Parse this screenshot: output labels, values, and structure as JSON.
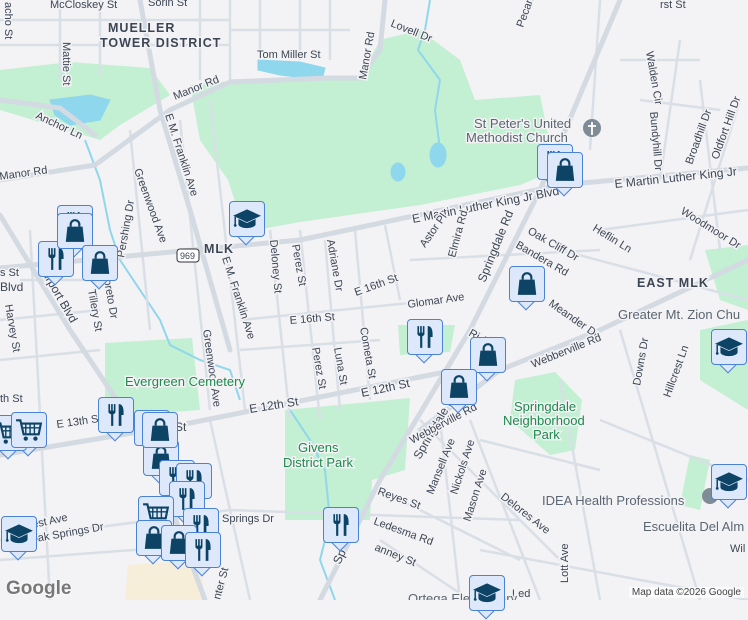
{
  "colors": {
    "background": "#f3f2f4",
    "park": "#c3efd3",
    "water": "#8fd7ec",
    "road": "#d5dce3",
    "marker_fill": "#dde8fb",
    "marker_border": "#4a83d6",
    "icon": "#0d4466"
  },
  "labels": {
    "mueller_1": "MUELLER",
    "mueller_2": "TOWER DISTRICT",
    "east_mlk": "EAST MLK",
    "mccloskey": "McCloskey St",
    "sorin": "Sorin St",
    "camacho": "acho St",
    "mattie": "Mattie St",
    "tom_miller": "Tom Miller St",
    "manor_rd_1": "Manor Rd",
    "manor_rd_2": "Manor Rd",
    "manor_rd_3": "Manor Rd",
    "anchor": "Anchor Ln",
    "lovell": "Lovell Dr",
    "pecan": "Pecan",
    "emfranklin_1": "E M. Franklin Ave",
    "emfranklin_2": "E M. Franklin Ave",
    "greenwood_1": "Greenwood Ave",
    "greenwood_2": "Greenwood Ave",
    "pershing": "Pershing Dr",
    "mlk": "MLK",
    "hwy": "969",
    "deloney": "Deloney St",
    "perez_1": "Perez St",
    "perez_2": "Perez St",
    "adriane": "Adriane Dr",
    "luna": "Luna St",
    "cometa": "Cometa St",
    "e16th_1": "E 16th St",
    "e16th_2": "E 16th St",
    "e12th_1": "E 12th St",
    "e12th_2": "E 12th St",
    "e13th": "E 13th St",
    "mlk_long_1": "E Martin Luther King Jr Blvd",
    "mlk_long_2": "E Martin Luther King Jr",
    "springdale_1": "Springdale Rd",
    "springdale_2": "Springdale Rd",
    "springdale_3": "Sp",
    "astor": "Astor Pl",
    "elmira": "Elmira Rd",
    "oak_cliff": "Oak Cliff Dr",
    "bandera": "Bandera Rd",
    "heflin": "Heflin Ln",
    "woodmoor": "Woodmoor Dr",
    "walden": "Walden Cir",
    "bundyhill": "Bundyhill Dr",
    "broadhill": "Broadhill Dr",
    "oldfort": "Oldfort Hill Dr",
    "glomar": "Glomar Ave",
    "meander": "Meander Dr",
    "ridge": "Ri     Ave",
    "webberville_1": "Webberville Rd",
    "webberville_2": "Webberville Rd",
    "downs": "Downs Dr",
    "hillcrest": "Hillcrest Ln",
    "mansell": "Mansell Ave",
    "nickols": "Nickols Ave",
    "mason": "Mason Ave",
    "delores": "Delores Ave",
    "lott": "Lott Ave",
    "reyes": "Reyes St",
    "ledesma": "Ledesma Rd",
    "channey": "anney St",
    "airport": "Airport Blvd",
    "blvd": "Blvd",
    "harvey": "Harvey St",
    "tillery": "Tillery St",
    "loreto": "oreto Dr",
    "oak_springs": "Oak Springs Dr",
    "springs_dr": "Springs Dr",
    "crest": "est Ave",
    "center": "nter St",
    "bs_st": "s St",
    "th_st": "th St",
    "rst_st": "rst St",
    "wil": "Wil",
    "st_12": "St",
    "led": "Led",
    "evergreen": "Evergreen Cemetery",
    "givens_1": "Givens",
    "givens_2": "District Park",
    "springdale_park_1": "Springdale",
    "springdale_park_2": "Neighborhood",
    "springdale_park_3": "Park",
    "st_peters_1": "St Peter's United",
    "st_peters_2": "Methodist Church",
    "mt_zion": "Greater Mt. Zion Chu",
    "idea": "IDEA Health Professions",
    "escuelita": "Escuelita Del Alm",
    "ortega": "Ortega Elementary"
  },
  "markers": [
    "restaurant",
    "school",
    "restaurant",
    "shopping",
    "shopping",
    "restaurant",
    "shopping",
    "shopping",
    "restaurant",
    "shopping",
    "shopping",
    "school",
    "school",
    "school",
    "grocery",
    "grocery",
    "restaurant",
    "shopping",
    "shopping",
    "restaurant",
    "restaurant",
    "restaurant",
    "grocery",
    "restaurant",
    "shopping",
    "shopping",
    "restaurant",
    "school",
    "restaurant",
    "shopping"
  ],
  "footer": {
    "logo": "Google",
    "attribution": "Map data ©2026 Google"
  }
}
